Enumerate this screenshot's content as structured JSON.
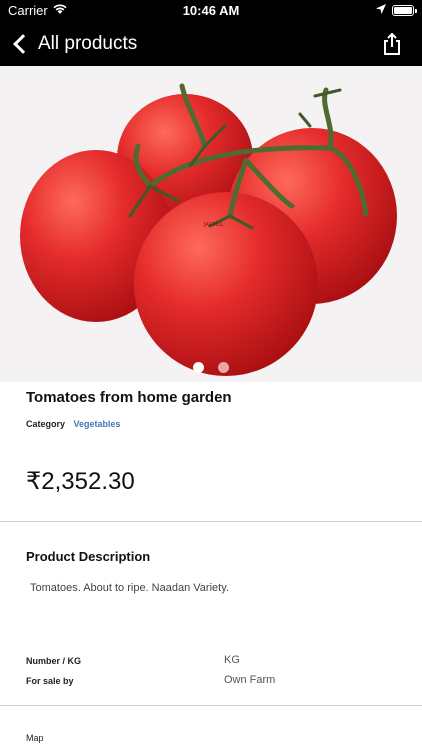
{
  "status_bar": {
    "carrier": "Carrier",
    "time": "10:46 AM"
  },
  "nav": {
    "back_label": "All products",
    "share_icon": "share-icon"
  },
  "gallery": {
    "image": "tomatoes",
    "watermark": "JAGMUL",
    "page_count": 2,
    "current_page": 1
  },
  "product": {
    "title": "Tomatoes from home garden",
    "category_label": "Category",
    "category_value": "Vegetables",
    "price": "₹2,352.30"
  },
  "description": {
    "heading": "Product Description",
    "text": "Tomatoes. About to ripe. Naadan Variety."
  },
  "specs": [
    {
      "label": "Number / KG",
      "value": "KG"
    },
    {
      "label": "For sale by",
      "value": "Own Farm"
    }
  ],
  "map": {
    "label": "Map"
  },
  "colors": {
    "nav_bg": "#000000",
    "category_link": "#3d7bb5",
    "tomato": "#e42b2b"
  }
}
